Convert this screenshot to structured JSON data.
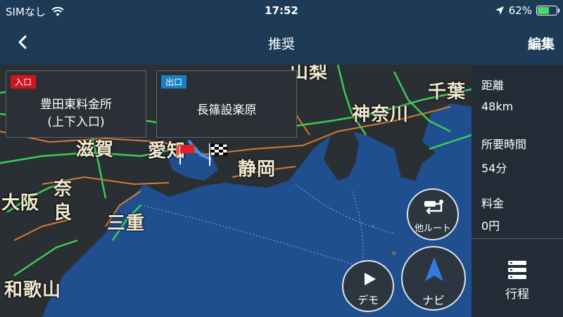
{
  "status_bar": {
    "carrier": "SIMなし",
    "time": "17:52",
    "battery_percent": "62%",
    "battery_level": 0.62
  },
  "nav": {
    "back_icon": "chevron-left-icon",
    "title": "推奨",
    "edit_label": "編集"
  },
  "entry_card": {
    "badge": "入口",
    "badge_color": "#d0161c",
    "line1": "豊田東料金所",
    "line2": "(上下入口)"
  },
  "exit_card": {
    "badge": "出口",
    "badge_color": "#1a7fc4",
    "line1": "長篠設楽原"
  },
  "map_labels": {
    "shiga": "滋賀",
    "aichi": "愛知",
    "shizuoka": "静岡",
    "kanagawa": "神奈川",
    "chiba": "千葉",
    "yamanashi": "山梨",
    "osaka": "大阪",
    "nara": "奈良",
    "mie": "三重",
    "wakayama": "和歌山"
  },
  "route_info": {
    "distance_label": "距離",
    "distance_value": "48km",
    "duration_label": "所要時間",
    "duration_value": "54分",
    "toll_label": "料金",
    "toll_value": "0円",
    "itinerary_label": "行程"
  },
  "buttons": {
    "other_route_label": "他ルート",
    "demo_label": "デモ",
    "navi_label": "ナビ"
  },
  "colors": {
    "sea": "#1f4f8f",
    "land": "#2a2f33",
    "highway": "#3ccc55",
    "road": "#d87a2e",
    "accent_navi": "#2f7de0"
  }
}
